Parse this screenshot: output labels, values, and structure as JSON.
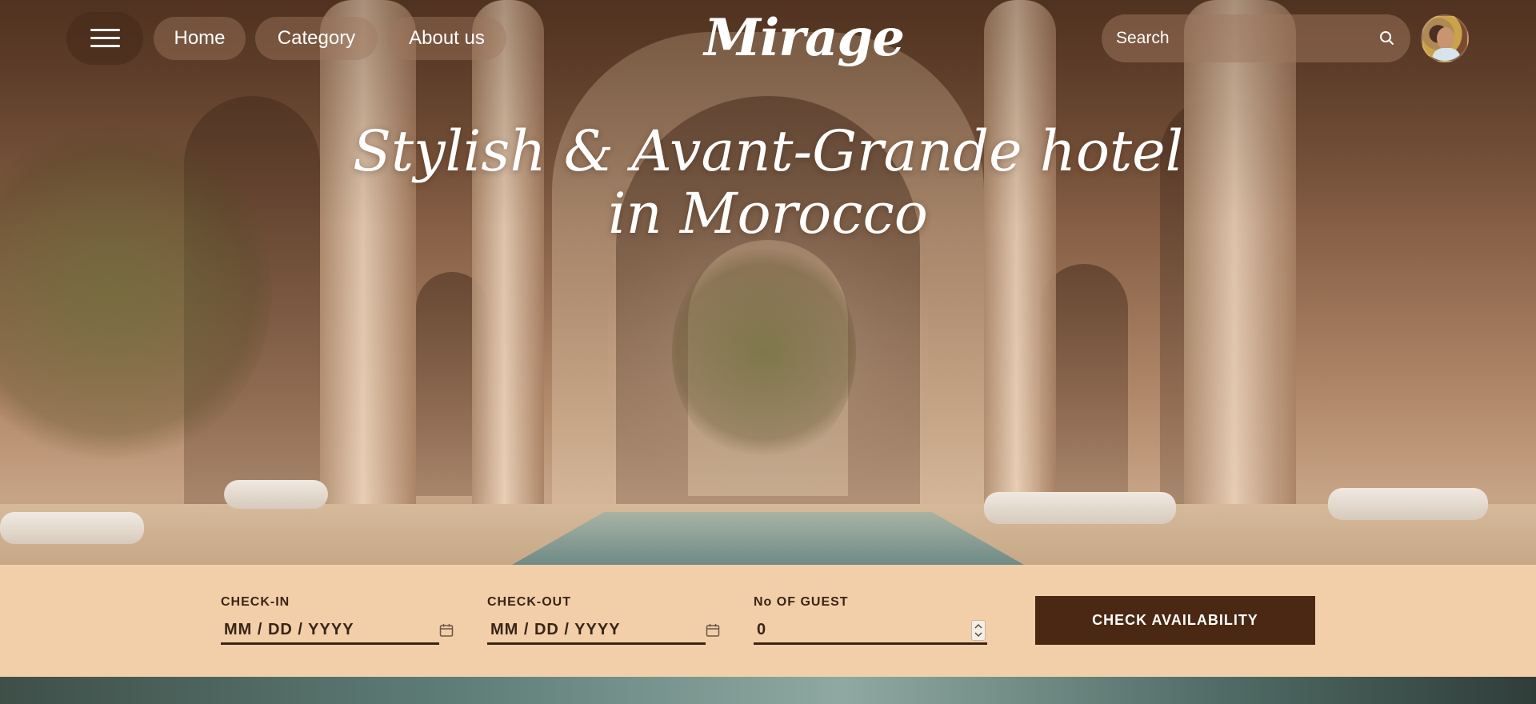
{
  "nav": {
    "menu_icon": "hamburger-menu-icon",
    "links": [
      {
        "label": "Home"
      },
      {
        "label": "Category"
      },
      {
        "label": "About us"
      }
    ],
    "logo": "Mirage",
    "search": {
      "placeholder": "Search",
      "value": "",
      "icon": "search-icon"
    },
    "avatar_icon": "user-avatar"
  },
  "hero": {
    "headline": "Stylish & Avant-Grande hotel in Morocco"
  },
  "booking": {
    "checkin": {
      "label": "CHECK-IN",
      "placeholder": "MM / DD / YYYY",
      "icon": "calendar-icon"
    },
    "checkout": {
      "label": "CHECK-OUT",
      "placeholder": "MM / DD / YYYY",
      "icon": "calendar-icon"
    },
    "guests": {
      "label": "No OF GUEST",
      "value": "0"
    },
    "submit_label": "CHECK AVAILABILITY"
  },
  "colors": {
    "booking_bg": "#f2cfa9",
    "button_bg": "#4a2814",
    "text_dark": "#3a2418"
  }
}
